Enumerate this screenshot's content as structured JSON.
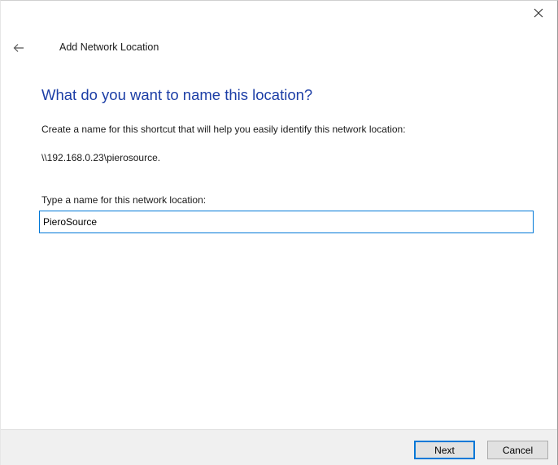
{
  "window": {
    "title": "Add Network Location",
    "close_icon": "close-icon",
    "back_icon": "back-arrow-icon"
  },
  "content": {
    "heading": "What do you want to name this location?",
    "description": "Create a name for this shortcut that will help you easily identify this network location:",
    "network_path": "\\\\192.168.0.23\\pierosource.",
    "field_label": "Type a name for this network location:",
    "field_value": "PieroSource"
  },
  "footer": {
    "next_label": "Next",
    "cancel_label": "Cancel"
  },
  "colors": {
    "heading": "#1c3ea6",
    "focus_accent": "#0078d7",
    "footer_background": "#f0f0f0"
  }
}
